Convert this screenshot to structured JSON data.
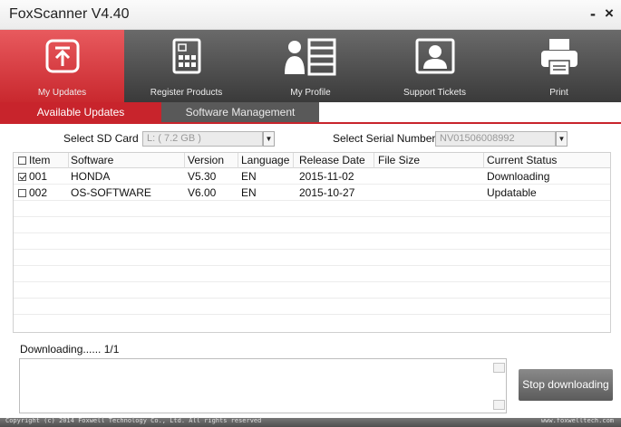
{
  "window": {
    "title": "FoxScanner  V4.40",
    "minimize": "-",
    "close": "×"
  },
  "toolbar": {
    "items": [
      {
        "label": "My Updates",
        "icon": "download-box-icon"
      },
      {
        "label": "Register Products",
        "icon": "register-device-icon"
      },
      {
        "label": "My Profile",
        "icon": "profile-list-icon"
      },
      {
        "label": "Support Tickets",
        "icon": "support-person-icon"
      },
      {
        "label": "Print",
        "icon": "printer-icon"
      }
    ]
  },
  "tabs": [
    {
      "label": "Available Updates"
    },
    {
      "label": "Software Management"
    }
  ],
  "filters": {
    "sd_card_label": "Select SD Card",
    "sd_card_value": "L:  ( 7.2 GB )",
    "serial_label": "Select Serial Number",
    "serial_value": "NV01506008992"
  },
  "table": {
    "headers": [
      "Item",
      "Software",
      "Version",
      "Language",
      "Release Date",
      "File Size",
      "Current Status"
    ],
    "rows": [
      {
        "item": "001",
        "checked": true,
        "software": "HONDA",
        "version": "V5.30",
        "language": "EN",
        "release_date": "2015-11-02",
        "file_size": "",
        "status": "Downloading"
      },
      {
        "item": "002",
        "checked": false,
        "software": "OS-SOFTWARE",
        "version": "V6.00",
        "language": "EN",
        "release_date": "2015-10-27",
        "file_size": "",
        "status": "Updatable"
      }
    ]
  },
  "progress": {
    "status_text": "Downloading......  1/1"
  },
  "buttons": {
    "stop": "Stop downloading"
  },
  "footer": {
    "copyright": "Copyright (c) 2014 Foxwell Technology Co., Ltd. All rights reserved",
    "website": "www.foxwelltech.com"
  },
  "colors": {
    "accent": "#c8242c",
    "toolbar": "#4a4a4a",
    "inactive_tab": "#595959"
  }
}
